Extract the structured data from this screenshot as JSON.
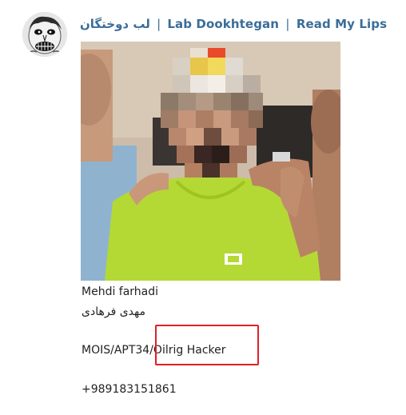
{
  "channel": {
    "name_fa": "لب دوختگان",
    "name_en": "Lab Dookhtegan",
    "name_alt": "Read My Lips",
    "separator": "|",
    "avatar_icon": "stitched-lips-face-icon"
  },
  "post": {
    "photo_icon": "pixelated-group-photo",
    "lines": {
      "name_en": "Mehdi farhadi",
      "name_fa": "مهدی فرهادی",
      "affiliation": "MOIS/APT34/Oilrig Hacker",
      "phone": "+989183151861"
    }
  },
  "annotation": {
    "highlight_color": "#e01f26"
  },
  "colors": {
    "title": "#3a6d99",
    "text": "#222222"
  }
}
